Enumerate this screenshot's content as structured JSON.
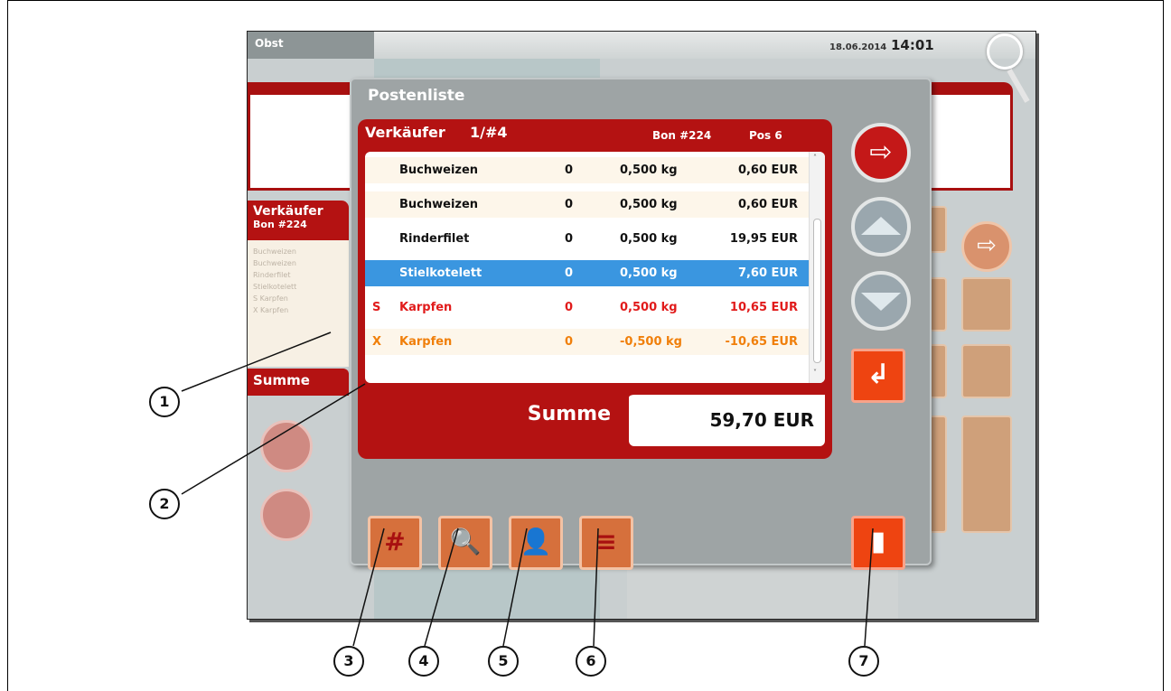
{
  "screen": {
    "topbar": {
      "tab": "Obst",
      "date": "18.06.2014",
      "time": "14:01"
    },
    "left_panel": {
      "title": "Verkäufer",
      "bon": "Bon #224",
      "items": [
        "Buchweizen",
        "Buchweizen",
        "Rinderfilet",
        "Stielkotelett",
        "S  Karpfen",
        "X  Karpfen"
      ],
      "sum_label": "Summe"
    }
  },
  "dialog": {
    "title": "Postenliste",
    "header": {
      "seller": "Verkäufer",
      "seller_num": "1/#4",
      "bon": "Bon #224",
      "pos": "Pos 6"
    },
    "rows": [
      {
        "mark": "",
        "name": "Buchweizen",
        "qty": "0",
        "weight": "0,500 kg",
        "price": "0,60 EUR"
      },
      {
        "mark": "",
        "name": "Buchweizen",
        "qty": "0",
        "weight": "0,500 kg",
        "price": "0,60 EUR"
      },
      {
        "mark": "",
        "name": "Rinderfilet",
        "qty": "0",
        "weight": "0,500 kg",
        "price": "19,95 EUR"
      },
      {
        "mark": "",
        "name": "Stielkotelett",
        "qty": "0",
        "weight": "0,500 kg",
        "price": "7,60 EUR"
      },
      {
        "mark": "S",
        "name": "Karpfen",
        "qty": "0",
        "weight": "0,500 kg",
        "price": "10,65 EUR"
      },
      {
        "mark": "X",
        "name": "Karpfen",
        "qty": "0",
        "weight": "-0,500 kg",
        "price": "-10,65 EUR"
      }
    ],
    "sum_label": "Summe",
    "sum_value": "59,70 EUR",
    "scroll": {
      "up": "˄",
      "down": "˅"
    },
    "icons": {
      "exit": "exit-door-icon",
      "up": "arrow-up-icon",
      "down": "arrow-down-icon",
      "enter": "enter-return-icon",
      "delete": "trash-icon",
      "tools": [
        "receipt-number-icon",
        "receipt-search-icon",
        "seller-receipt-icon",
        "receipt-list-icon"
      ]
    },
    "glyphs": {
      "exit": "⇨",
      "enter": "↲",
      "delete": "▮",
      "tools": [
        "#",
        "🔍",
        "👤",
        "≡"
      ]
    }
  },
  "callouts": [
    "1",
    "2",
    "3",
    "4",
    "5",
    "6",
    "7"
  ],
  "colors": {
    "dialog_red": "#b41212",
    "selected_row": "#3a96e0",
    "storno_row": "#e11b1b",
    "cancel_row": "#f07f0a",
    "row_tint": "#fdf6ea",
    "button_orange": "#ee4411"
  }
}
